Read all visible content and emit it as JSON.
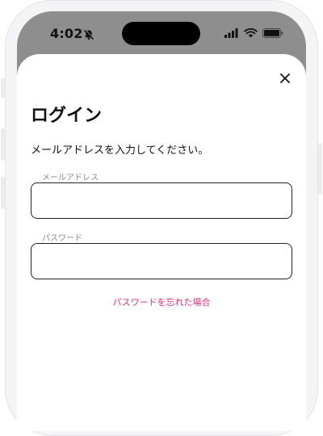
{
  "status_bar": {
    "time": "4:02",
    "icons": [
      "bell-slash-icon",
      "cellular-signal-icon",
      "wifi-icon",
      "battery-icon"
    ]
  },
  "login_sheet": {
    "close_icon": "close-icon",
    "title": "ログイン",
    "description": "メールアドレスを入力してください。",
    "email": {
      "label": "メールアドレス",
      "value": "",
      "placeholder": ""
    },
    "password": {
      "label": "パスワード",
      "value": "",
      "placeholder": ""
    },
    "forgot_password_link": "パスワードを忘れた場合"
  },
  "colors": {
    "accent_link": "#e0307a",
    "status_bar_bg": "#8e8e8e",
    "field_border": "#222222",
    "label_gray": "#8a8a8a"
  }
}
